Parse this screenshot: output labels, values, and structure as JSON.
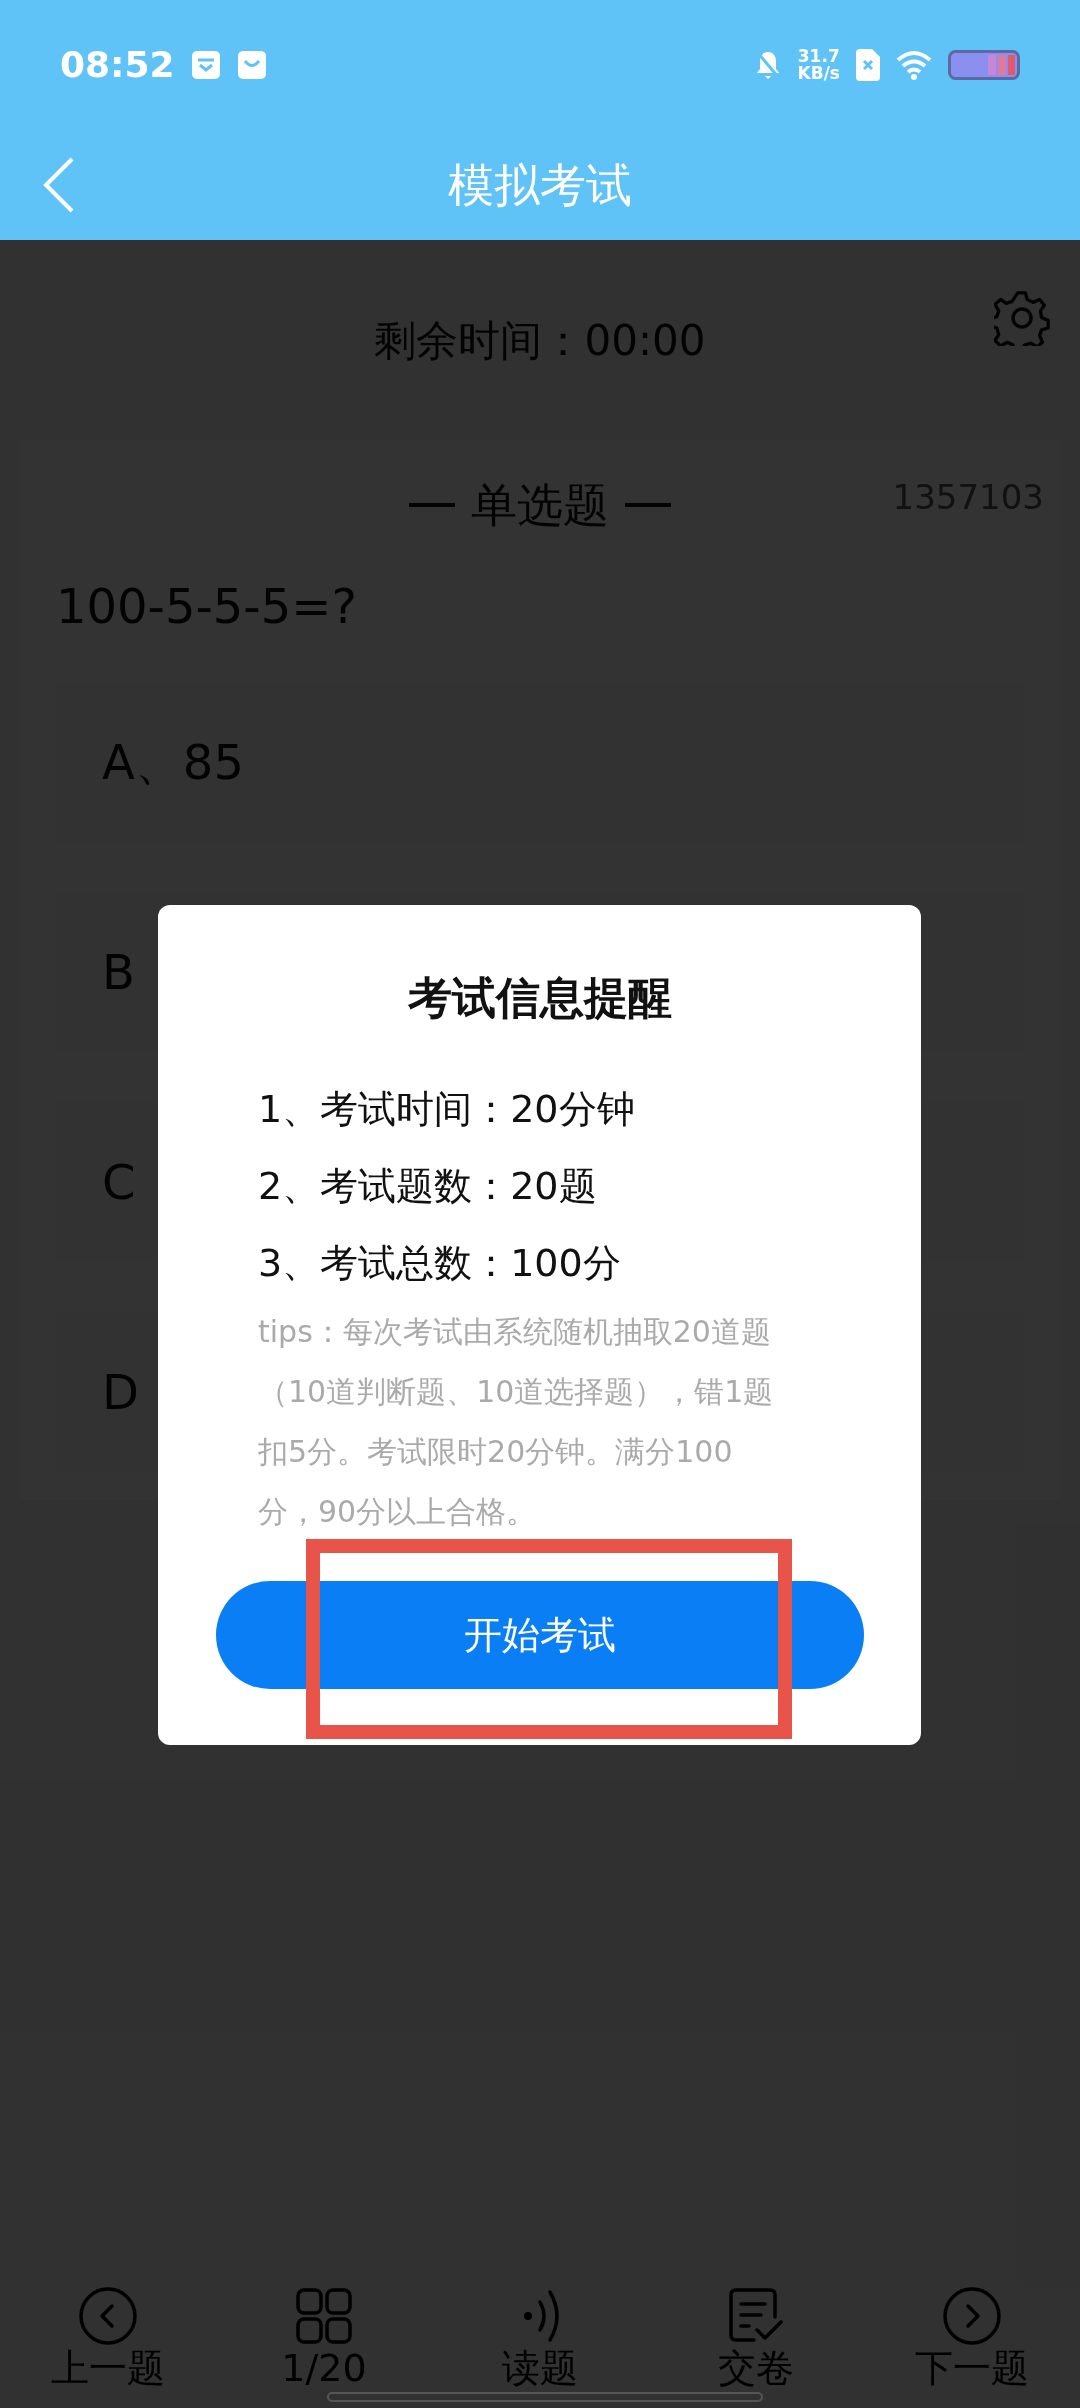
{
  "status_bar": {
    "time": "08:52",
    "net_speed_value": "31.7",
    "net_speed_unit": "KB/s"
  },
  "header": {
    "title": "模拟考试"
  },
  "timer": {
    "label": "剩余时间：00:00"
  },
  "question": {
    "type_label": "单选题",
    "id": "1357103",
    "text": "100-5-5-5=?",
    "options": [
      {
        "label": "A、85"
      },
      {
        "label": "B"
      },
      {
        "label": "C"
      },
      {
        "label": "D"
      }
    ]
  },
  "dialog": {
    "title": "考试信息提醒",
    "items": [
      "1、考试时间：20分钟",
      "2、考试题数：20题",
      "3、考试总数：100分"
    ],
    "tips": "tips：每次考试由系统随机抽取20道题（10道判断题、10道选择题），错1题扣5分。考试限时20分钟。满分100分，90分以上合格。",
    "button": {
      "label": "开始考试",
      "highlighted": true
    }
  },
  "bottom_nav": [
    {
      "kind": "prev",
      "label": "上一题"
    },
    {
      "kind": "grid",
      "label": "1/20"
    },
    {
      "kind": "audio",
      "label": "读题"
    },
    {
      "kind": "submit",
      "label": "交卷"
    },
    {
      "kind": "next",
      "label": "下一题"
    }
  ]
}
